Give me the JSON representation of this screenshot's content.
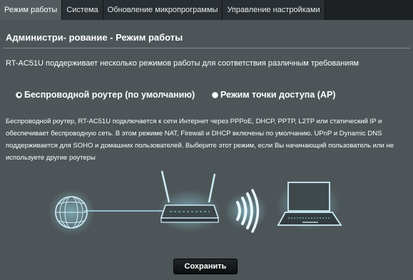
{
  "tabs": [
    {
      "label": "Режим работы",
      "active": true
    },
    {
      "label": "Система",
      "active": false
    },
    {
      "label": "Обновление микропрограммы",
      "active": false
    },
    {
      "label": "Управление настройками",
      "active": false
    }
  ],
  "page_title": "Администри- рование - Режим работы",
  "intro": "RT-AC51U поддерживает несколько режимов работы для соответствия различным требованиям",
  "modes": {
    "router_label": "Беспроводной роутер (по умолчанию)",
    "ap_label": "Режим точки доступа (AP)",
    "selected": "router"
  },
  "description": "Беспроводной роутер, RT-AC51U подключается к сети Интернет через PPPoE, DHCP, PPTP, L2TP или статический IP и обеспечивает беспроводную сеть. В этом режиме NAT, Firewall и DHCP включены по умолчанию. UPnP и Dynamic DNS поддерживается для SOHO и домашних пользователей. Выберите этот режим, если Вы начинающий пользователь или не используете другие роутеры",
  "save_label": "Сохранить",
  "colors": {
    "background": "#4d5558",
    "tab_bar": "#1d2124",
    "illustration_accent": "#8ad8ee"
  },
  "icons": [
    "globe-icon",
    "router-icon",
    "wireless-waves-icon",
    "laptop-icon"
  ]
}
